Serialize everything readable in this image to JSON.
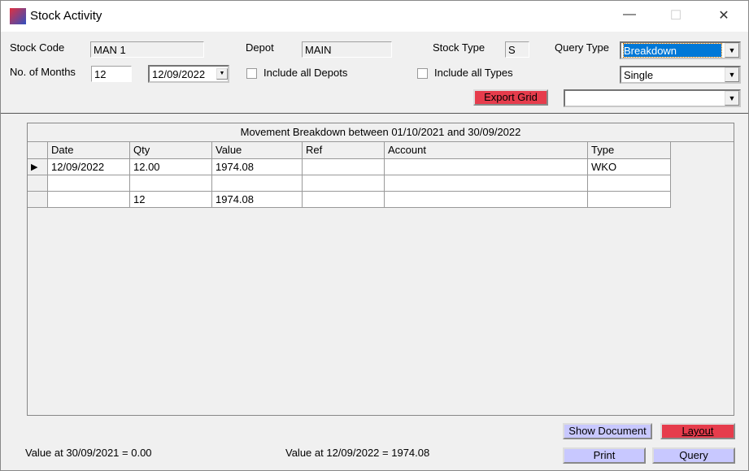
{
  "window": {
    "title": "Stock Activity",
    "minimize": "—",
    "maximize": "☐",
    "close": "✕"
  },
  "form": {
    "stock_code_label": "Stock Code",
    "stock_code": "MAN 1",
    "depot_label": "Depot",
    "depot": "MAIN",
    "stock_type_label": "Stock Type",
    "stock_type": "S",
    "query_type_label": "Query Type",
    "query_type": "Breakdown",
    "months_label": "No. of Months",
    "months": "12",
    "date": "12/09/2022",
    "include_depots": "Include all Depots",
    "include_types": "Include all Types",
    "mode": "Single",
    "export_label": "Export Grid",
    "export_target": ""
  },
  "grid": {
    "title": "Movement Breakdown between 01/10/2021 and 30/09/2022",
    "columns": [
      "Date",
      "Qty",
      "Value",
      "Ref",
      "Account",
      "Type"
    ],
    "rows": [
      [
        "12/09/2022",
        "12.00",
        "1974.08",
        "",
        "",
        "WKO"
      ],
      [
        "",
        "",
        "",
        "",
        "",
        ""
      ],
      [
        "",
        "12",
        "1974.08",
        "",
        "",
        ""
      ]
    ],
    "current_row_marker": "▶"
  },
  "footer": {
    "value_start": "Value at 30/09/2021 = 0.00",
    "value_end": "Value at 12/09/2022 = 1974.08",
    "show_document": "Show Document",
    "layout": "Layout",
    "print": "Print",
    "query": "Query"
  },
  "colors": {
    "accent_red": "#e63c4c",
    "button_blue": "#c8c8ff",
    "selection": "#0078d7"
  }
}
